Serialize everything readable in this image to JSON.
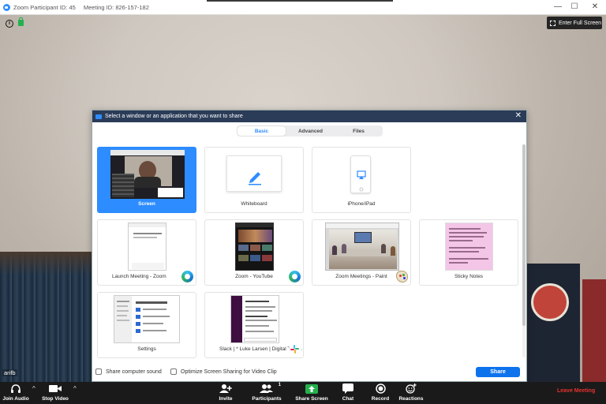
{
  "window": {
    "title_participant": "Zoom Participant ID: 45",
    "title_meeting": "Meeting ID: 826-157-182",
    "minimize": "—",
    "maximize": "☐",
    "close": "✕"
  },
  "video": {
    "enter_full_screen": "Enter Full Screen",
    "participant_name": "arifb"
  },
  "dialog": {
    "title": "Select a window or an application that you want to share",
    "close": "✕",
    "tabs": [
      {
        "label": "Basic",
        "active": true
      },
      {
        "label": "Advanced",
        "active": false
      },
      {
        "label": "Files",
        "active": false
      }
    ],
    "tiles": [
      {
        "label": "Screen",
        "selected": true
      },
      {
        "label": "Whiteboard"
      },
      {
        "label": "iPhone/iPad"
      },
      {
        "label": "Launch Meeting - Zoom",
        "app_icon": "edge-icon"
      },
      {
        "label": "Zoom - YouTube",
        "app_icon": "edge-icon"
      },
      {
        "label": "Zoom Meetings - Paint",
        "app_icon": "paint-icon"
      },
      {
        "label": "Sticky Notes"
      },
      {
        "label": "Settings"
      },
      {
        "label": "Slack | * Luke Larsen | Digital Tren...",
        "app_icon": "slack-icon"
      }
    ],
    "share_sound": "Share computer sound",
    "optimize_video": "Optimize Screen Sharing for Video Clip",
    "share_button": "Share"
  },
  "toolbar": {
    "join_audio": "Join Audio",
    "stop_video": "Stop Video",
    "invite": "Invite",
    "participants": "Participants",
    "participants_count": "1",
    "share_screen": "Share Screen",
    "chat": "Chat",
    "record": "Record",
    "reactions": "Reactions",
    "leave_meeting": "Leave Meeting"
  },
  "colors": {
    "accent": "#2d8cff",
    "share_green": "#23b14d",
    "leave_red": "#e8322f"
  }
}
